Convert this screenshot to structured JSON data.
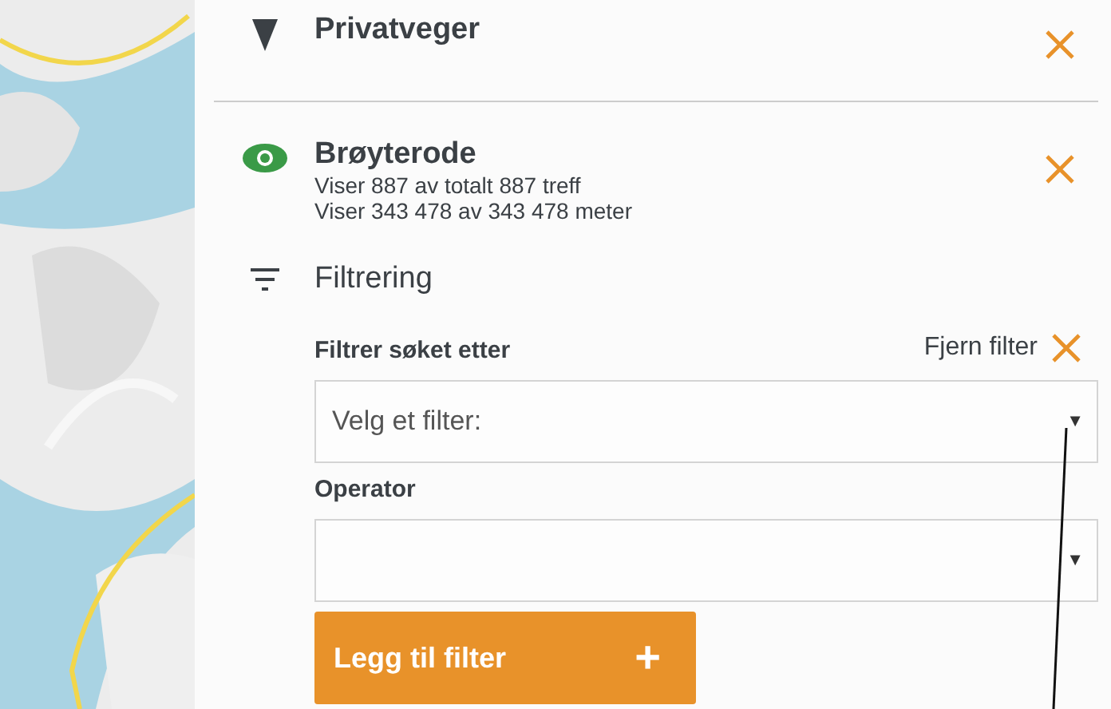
{
  "layers": [
    {
      "title": "Privatveger",
      "kind": "category"
    },
    {
      "title": "Brøyterode",
      "kind": "layer",
      "lines": [
        "Viser 887 av totalt 887 treff",
        "Viser 343 478 av 343 478 meter"
      ]
    }
  ],
  "filter": {
    "title": "Filtrering",
    "field_label": "Filtrer søket etter",
    "remove_label": "Fjern filter",
    "field": {
      "placeholder": "Velg et filter:",
      "arrow": "▼"
    },
    "operator_label": "Operator",
    "operator": {
      "arrow": "▼"
    },
    "add_button": {
      "label": "Legg til filter",
      "icon": "+"
    }
  }
}
